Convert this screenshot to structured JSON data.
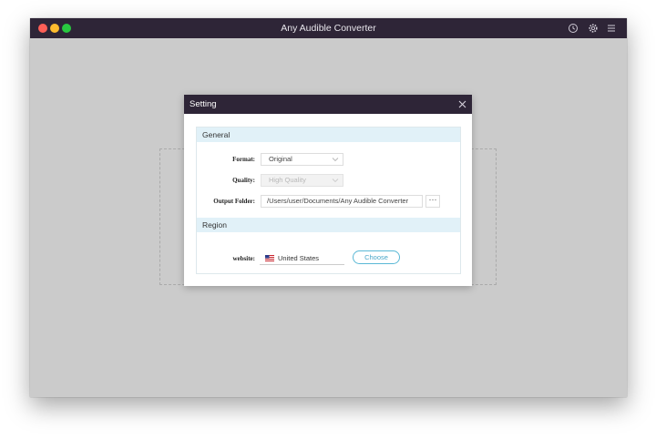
{
  "app": {
    "title": "Any Audible Converter",
    "icons": [
      "history-icon",
      "gear-icon",
      "menu-icon"
    ]
  },
  "dialog": {
    "title": "Setting",
    "general": {
      "heading": "General",
      "format_label": "Format:",
      "format_value": "Original",
      "quality_label": "Quality:",
      "quality_value": "High Quality",
      "output_label": "Output Folder:",
      "output_value": "/Users/user/Documents/Any Audible Converter",
      "browse_label": "···"
    },
    "region": {
      "heading": "Region",
      "website_label": "website:",
      "country_value": "United States",
      "choose_label": "Choose"
    }
  },
  "colors": {
    "titlebar": "#2e2537",
    "section_bg": "#e1f1f8",
    "accent": "#4aa7c9",
    "workspace": "#cbcbcb"
  }
}
